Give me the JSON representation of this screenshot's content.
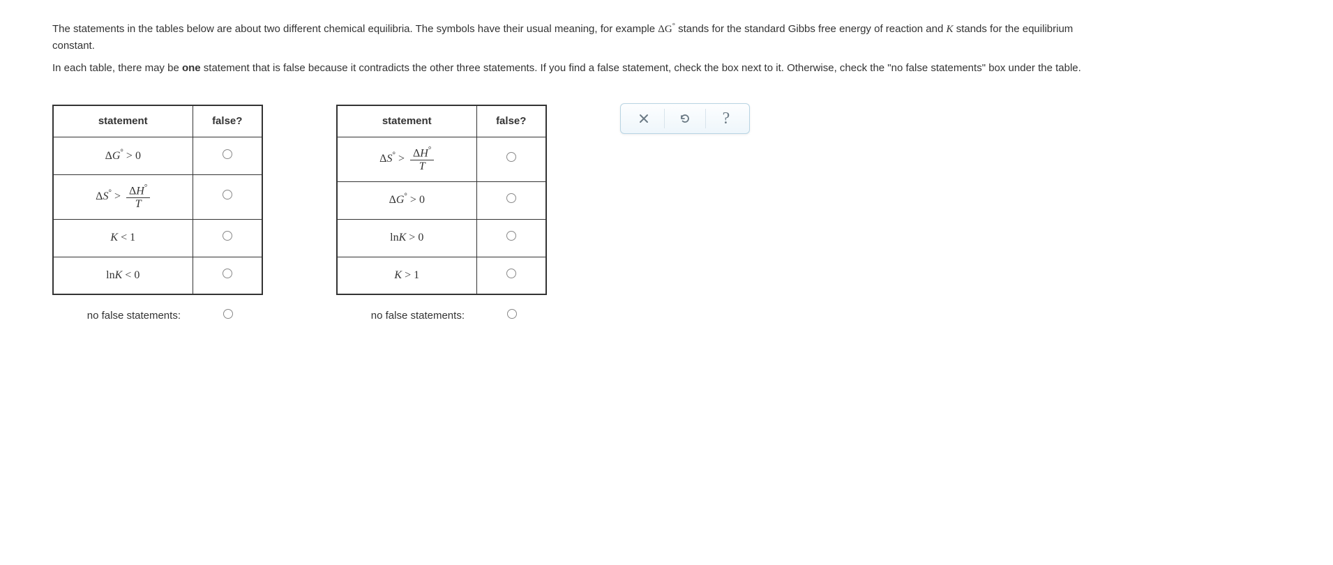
{
  "intro": {
    "p1_a": "The statements in the tables below are about two different chemical equilibria. The symbols have their usual meaning, for example ",
    "p1_dg": "ΔG",
    "p1_deg": "°",
    "p1_b": " stands for the standard Gibbs free energy of reaction and ",
    "p1_k": "K",
    "p1_c": " stands for the equilibrium constant.",
    "p2_a": "In each table, there may be ",
    "p2_one": "one",
    "p2_b": " statement that is false because it contradicts the other three statements. If you find a false statement, check the box next to it. Otherwise, check the \"no false statements\" box under the table."
  },
  "headers": {
    "statement": "statement",
    "false": "false?"
  },
  "table1": {
    "rows": [
      {
        "type": "dg_gt0"
      },
      {
        "type": "ds_gt_dh_t"
      },
      {
        "type": "k_lt1"
      },
      {
        "type": "lnk_lt0"
      }
    ],
    "nofalse": "no false statements:"
  },
  "table2": {
    "rows": [
      {
        "type": "ds_gt_dh_t"
      },
      {
        "type": "dg_gt0"
      },
      {
        "type": "lnk_gt0"
      },
      {
        "type": "k_gt1"
      }
    ],
    "nofalse": "no false statements:"
  },
  "math_text": {
    "delta": "Δ",
    "G": "G",
    "S": "S",
    "H": "H",
    "K": "K",
    "T": "T",
    "ln": "ln",
    "deg": "°",
    "gt": ">",
    "lt": "<",
    "zero": "0",
    "one": "1"
  }
}
